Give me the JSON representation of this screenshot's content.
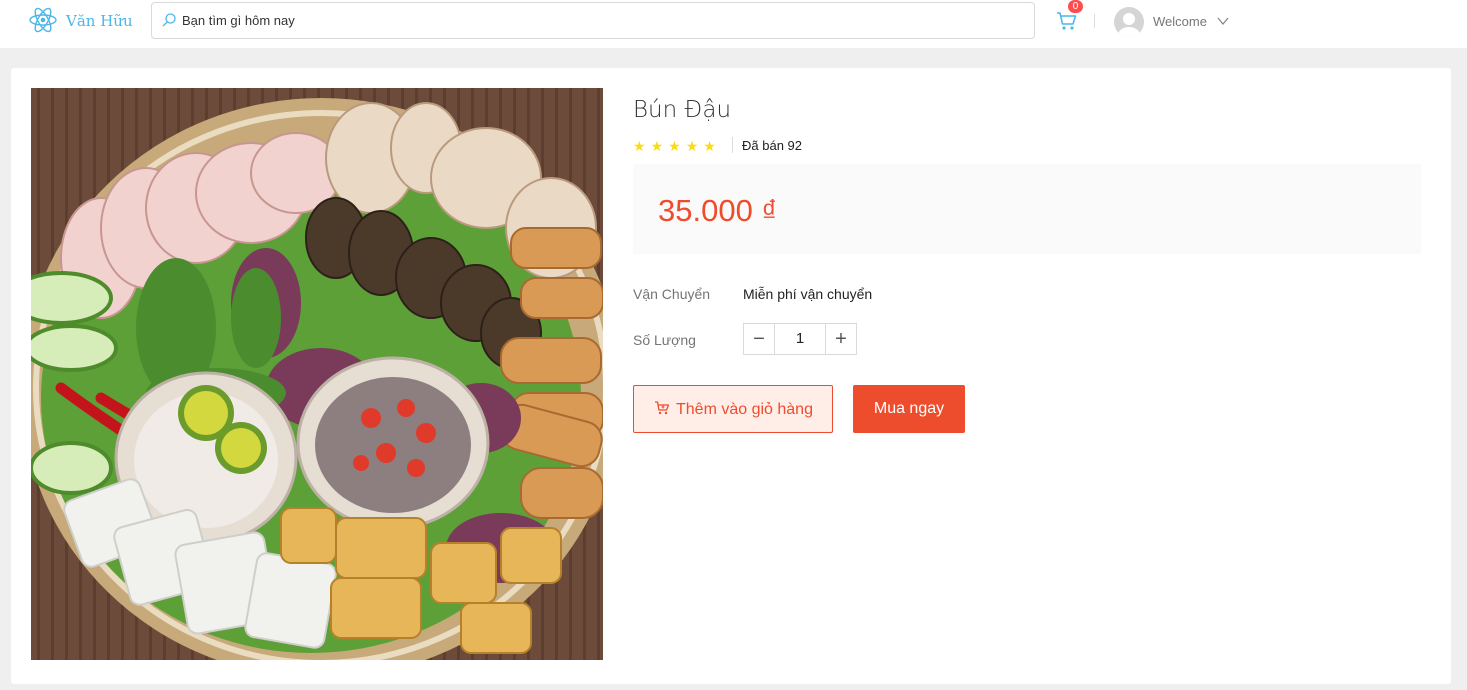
{
  "header": {
    "brand": "Văn Hữu",
    "search_placeholder": "Bạn tìm gì hôm nay",
    "cart_count": "0",
    "welcome": "Welcome"
  },
  "product": {
    "title": "Bún Đậu",
    "rating_stars": 5,
    "sold": "Đã bán 92",
    "price": "35.000 ₫",
    "shipping_label": "Vận Chuyển",
    "shipping_value": "Miễn phí vận chuyển",
    "quantity_label": "Số Lượng",
    "quantity": "1",
    "decrement": "−",
    "increment": "+",
    "add_to_cart": "Thêm vào giỏ hàng",
    "buy_now": "Mua ngay"
  },
  "colors": {
    "accent": "#ee4d2d",
    "brand": "#4db6e8",
    "star": "#fadb14"
  },
  "icons": [
    "react-logo-icon",
    "search-icon",
    "cart-icon",
    "avatar-icon",
    "chevron-down-icon",
    "star-icon",
    "cart-add-icon"
  ]
}
